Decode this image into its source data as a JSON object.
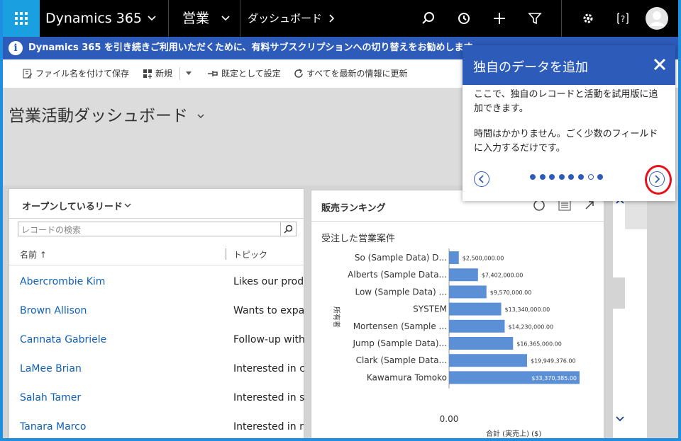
{
  "topnav": {
    "app_name": "Dynamics 365",
    "area": "営業",
    "page": "ダッシュボード"
  },
  "infobar": {
    "message": "Dynamics 365 を引き続きご利用いただくために、有料サブスクリプションへの切り替えをお勧めします"
  },
  "commands": {
    "save_as": "ファイル名を付けて保存",
    "new": "新規",
    "set_default": "既定として設定",
    "refresh_all": "すべてを最新の情報に更新"
  },
  "dashboard": {
    "title": "営業活動ダッシュボード"
  },
  "leads": {
    "title": "オープンしているリード",
    "search_placeholder": "レコードの検索",
    "col_name": "名前 ↑",
    "col_topic": "トピック",
    "rows": [
      {
        "name": "Abercrombie Kim",
        "topic": "Likes our prod"
      },
      {
        "name": "Brown Allison",
        "topic": "Wants to expa"
      },
      {
        "name": "Cannata Gabriele",
        "topic": "Follow-up with"
      },
      {
        "name": "LaMee Brian",
        "topic": "Interested in c"
      },
      {
        "name": "Salah Tamer",
        "topic": "Interested in s"
      },
      {
        "name": "Tanara Marco",
        "topic": "Interested in r"
      }
    ]
  },
  "ranking": {
    "title": "販売ランキング"
  },
  "chart_data": {
    "type": "bar",
    "orientation": "horizontal",
    "title": "受注した営業案件",
    "xlabel": "合計 (実売上) ($)",
    "ylabel": "所有者",
    "categories": [
      "So (Sample Data) D...",
      "Alberts (Sample Data...",
      "Low (Sample Data) ...",
      "SYSTEM",
      "Mortensen (Sample ...",
      "Jump (Sample Data)...",
      "Clark (Sample Data...",
      "Kawamura Tomoko"
    ],
    "values": [
      2500000,
      7402000,
      9570000,
      13340000,
      14230000,
      16365000,
      19949376,
      33370385
    ],
    "value_labels": [
      "$2,500,000.00",
      "$7,402,000.00",
      "$9,570,000.00",
      "$13,340,000.00",
      "$14,230,000.00",
      "$16,365,000.00",
      "$19,949,376.00",
      "$33,370,385.00"
    ],
    "x_tick_label": "0.00",
    "bar_color": "#5b8fd6"
  },
  "coach": {
    "title": "独自のデータを追加",
    "para1": "ここで、独自のレコードと活動を試用版に追加できます。",
    "para2": "時間はかかりません。ごく少数のフィールドに入力するだけです。",
    "dots_total": 8,
    "dots_current": 7
  },
  "colors": {
    "accent": "#2d5bb9",
    "waffle": "#1a9fe0",
    "highlight_ring": "#e8111b"
  }
}
